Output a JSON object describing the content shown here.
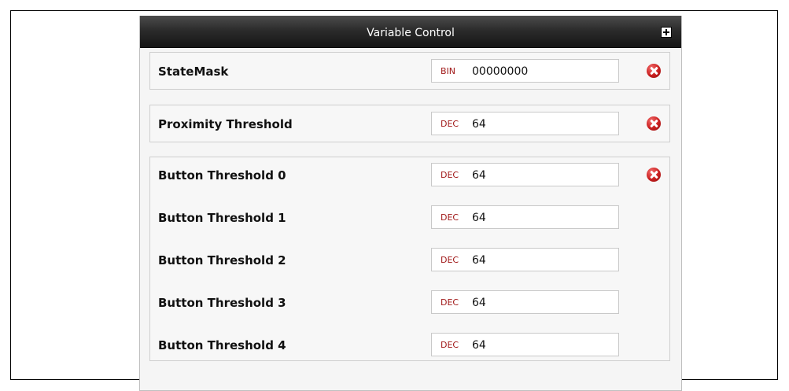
{
  "panel": {
    "title": "Variable Control",
    "expand_icon": "plus-square-icon"
  },
  "groups": [
    {
      "rows": [
        {
          "label": "StateMask",
          "format": "BIN",
          "value": "00000000",
          "removable": true
        }
      ]
    },
    {
      "rows": [
        {
          "label": "Proximity Threshold",
          "format": "DEC",
          "value": "64",
          "removable": true
        }
      ]
    },
    {
      "rows": [
        {
          "label": "Button Threshold 0",
          "format": "DEC",
          "value": "64",
          "removable": true
        },
        {
          "label": "Button Threshold 1",
          "format": "DEC",
          "value": "64",
          "removable": false
        },
        {
          "label": "Button Threshold 2",
          "format": "DEC",
          "value": "64",
          "removable": false
        },
        {
          "label": "Button Threshold 3",
          "format": "DEC",
          "value": "64",
          "removable": false
        },
        {
          "label": "Button Threshold 4",
          "format": "DEC",
          "value": "64",
          "removable": false
        }
      ]
    }
  ],
  "colors": {
    "format_tag": "#a01818",
    "remove_icon": "#c91f1f",
    "titlebar": "#2c2c2c"
  }
}
